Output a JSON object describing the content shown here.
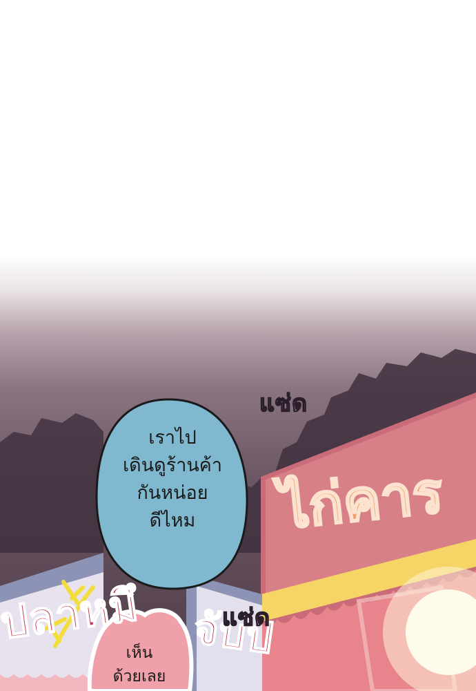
{
  "panel": {
    "sfx_top": "แซ่ด",
    "sfx_bottom": "แซ่ด",
    "speech_blue": [
      "เราไป",
      "เดินดูร้านค้า",
      "กันหน่อย",
      "ดีไหม"
    ],
    "speech_pink": [
      "เห็น",
      "ด้วยเลย"
    ],
    "sign_main": "ไก่คาร",
    "sign_left": "ปลาหมึ",
    "sign_mid": "จับป"
  },
  "colors": {
    "blue_bubble": "#80b8d0",
    "pink_bubble": "#f0a0a8",
    "sign_pink": "#d07080",
    "awning_yellow": "#f6d465"
  }
}
